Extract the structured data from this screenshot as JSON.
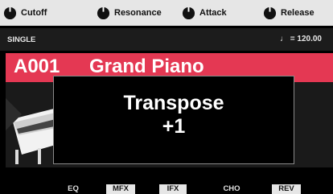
{
  "knobs": [
    {
      "label": "Cutoff",
      "icon": "knob-icon"
    },
    {
      "label": "Resonance",
      "icon": "knob-icon"
    },
    {
      "label": "Attack",
      "icon": "knob-icon"
    },
    {
      "label": "Release",
      "icon": "knob-icon"
    }
  ],
  "mode": {
    "label": "SINGLE"
  },
  "tempo": {
    "display": "♩ = 120.00"
  },
  "tone": {
    "number": "A001",
    "name": "Grand Piano"
  },
  "popup": {
    "title": "Transpose",
    "value": "+1"
  },
  "effects": [
    {
      "label": "EQ",
      "active": false
    },
    {
      "label": "MFX",
      "active": true
    },
    {
      "label": "IFX",
      "active": true
    },
    {
      "label": "CHO",
      "active": false
    },
    {
      "label": "REV",
      "active": true
    }
  ],
  "colors": {
    "banner": "#e43853",
    "knob_bar": "#e6e6e6",
    "background": "#000000"
  }
}
